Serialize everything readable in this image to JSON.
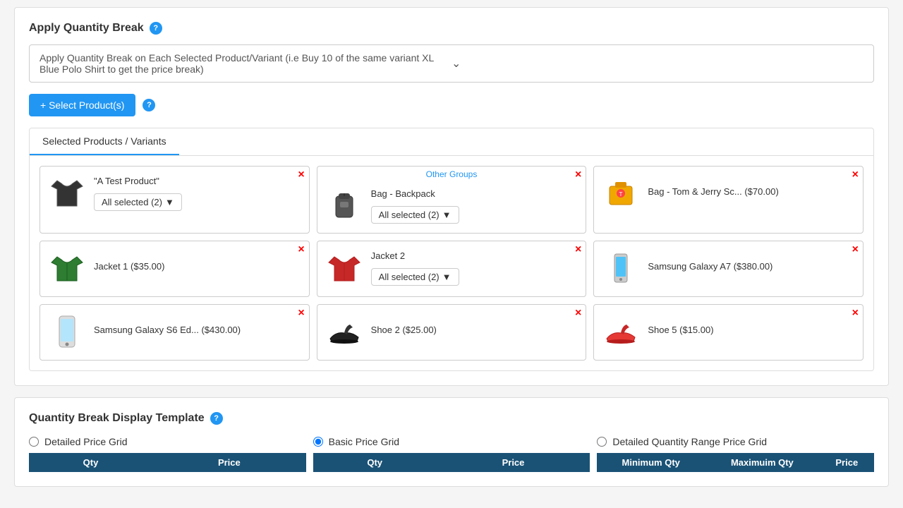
{
  "applyQuantityBreak": {
    "title": "Apply Quantity Break",
    "helpIcon": "?",
    "dropdown": {
      "value": "Apply Quantity Break on Each Selected Product/Variant (i.e Buy 10 of the same variant XL Blue Polo Shirt to get the price break)"
    },
    "selectButton": "+ Select Product(s)",
    "helpIcon2": "?"
  },
  "tab": {
    "label": "Selected Products / Variants"
  },
  "products": [
    {
      "id": "test-product",
      "name": "\"A Test Product\"",
      "hasVariantDropdown": true,
      "variantLabel": "All selected (2)",
      "imgType": "tshirt",
      "closeX": "×",
      "otherGroups": null
    },
    {
      "id": "bag-backpack",
      "name": "Bag - Backpack",
      "hasVariantDropdown": true,
      "variantLabel": "All selected (2)",
      "imgType": "backpack",
      "closeX": "×",
      "otherGroups": "Other Groups"
    },
    {
      "id": "bag-tom-jerry",
      "name": "Bag - Tom & Jerry Sc... ($70.00)",
      "hasVariantDropdown": false,
      "variantLabel": null,
      "imgType": "bag-yellow",
      "closeX": "×",
      "otherGroups": null
    },
    {
      "id": "jacket-1",
      "name": "Jacket 1 ($35.00)",
      "hasVariantDropdown": false,
      "variantLabel": null,
      "imgType": "jacket-green",
      "closeX": "×",
      "otherGroups": null
    },
    {
      "id": "jacket-2",
      "name": "Jacket 2",
      "hasVariantDropdown": true,
      "variantLabel": "All selected (2)",
      "imgType": "jacket-red",
      "closeX": "×",
      "otherGroups": null
    },
    {
      "id": "samsung-a7",
      "name": "Samsung Galaxy A7 ($380.00)",
      "hasVariantDropdown": false,
      "variantLabel": null,
      "imgType": "phone-a7",
      "closeX": "×",
      "otherGroups": null
    },
    {
      "id": "samsung-s6",
      "name": "Samsung Galaxy S6 Ed... ($430.00)",
      "hasVariantDropdown": false,
      "variantLabel": null,
      "imgType": "phone-s6",
      "closeX": "×",
      "otherGroups": null
    },
    {
      "id": "shoe-2",
      "name": "Shoe 2 ($25.00)",
      "hasVariantDropdown": false,
      "variantLabel": null,
      "imgType": "shoe-black",
      "closeX": "×",
      "otherGroups": null
    },
    {
      "id": "shoe-5",
      "name": "Shoe 5 ($15.00)",
      "hasVariantDropdown": false,
      "variantLabel": null,
      "imgType": "shoe-red",
      "closeX": "×",
      "otherGroups": null
    }
  ],
  "quantityBreakDisplay": {
    "title": "Quantity Break Display Template",
    "helpIcon": "?",
    "options": [
      {
        "id": "detailed",
        "label": "Detailed Price Grid",
        "selected": false,
        "headers": [
          "Qty",
          "Price"
        ]
      },
      {
        "id": "basic",
        "label": "Basic Price Grid",
        "selected": true,
        "headers": [
          "Qty",
          "Price"
        ]
      },
      {
        "id": "detailed-range",
        "label": "Detailed Quantity Range Price Grid",
        "selected": false,
        "headers": [
          "Minimum Qty",
          "Maximuim Qty",
          "Price"
        ]
      }
    ]
  }
}
